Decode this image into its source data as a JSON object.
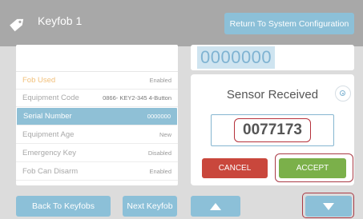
{
  "header": {
    "title": "Keyfob 1",
    "icon": "tag-icon",
    "return_label": "Return To System Configuration"
  },
  "details": {
    "rows": [
      {
        "label": "Fob Used",
        "value": "Enabled"
      },
      {
        "label": "Equipment Code",
        "value": "0866- KEY2-345 4-Button"
      },
      {
        "label": "Serial Number",
        "value": "0000000"
      },
      {
        "label": "Equipment Age",
        "value": "New"
      },
      {
        "label": "Emergency Key",
        "value": "Disabled"
      },
      {
        "label": "Fob Can Disarm",
        "value": "Enabled"
      }
    ]
  },
  "serial_display": "0000000",
  "dialog": {
    "title": "Sensor Received",
    "code": "0077173",
    "cancel_label": "CANCEL",
    "accept_label": "ACCEPT",
    "icon": "sensor-icon"
  },
  "footer": {
    "back_label": "Back To Keyfobs",
    "next_label": "Next Keyfob",
    "up_icon": "arrow-up-icon",
    "down_icon": "arrow-down-icon"
  },
  "colors": {
    "header_bg": "#a8a8a8",
    "accent_blue": "#8cc0d8",
    "cancel_red": "#c9473c",
    "accept_green": "#7bb04a",
    "highlight_outline": "#a93a45",
    "fob_used_orange": "#f2c07a"
  }
}
